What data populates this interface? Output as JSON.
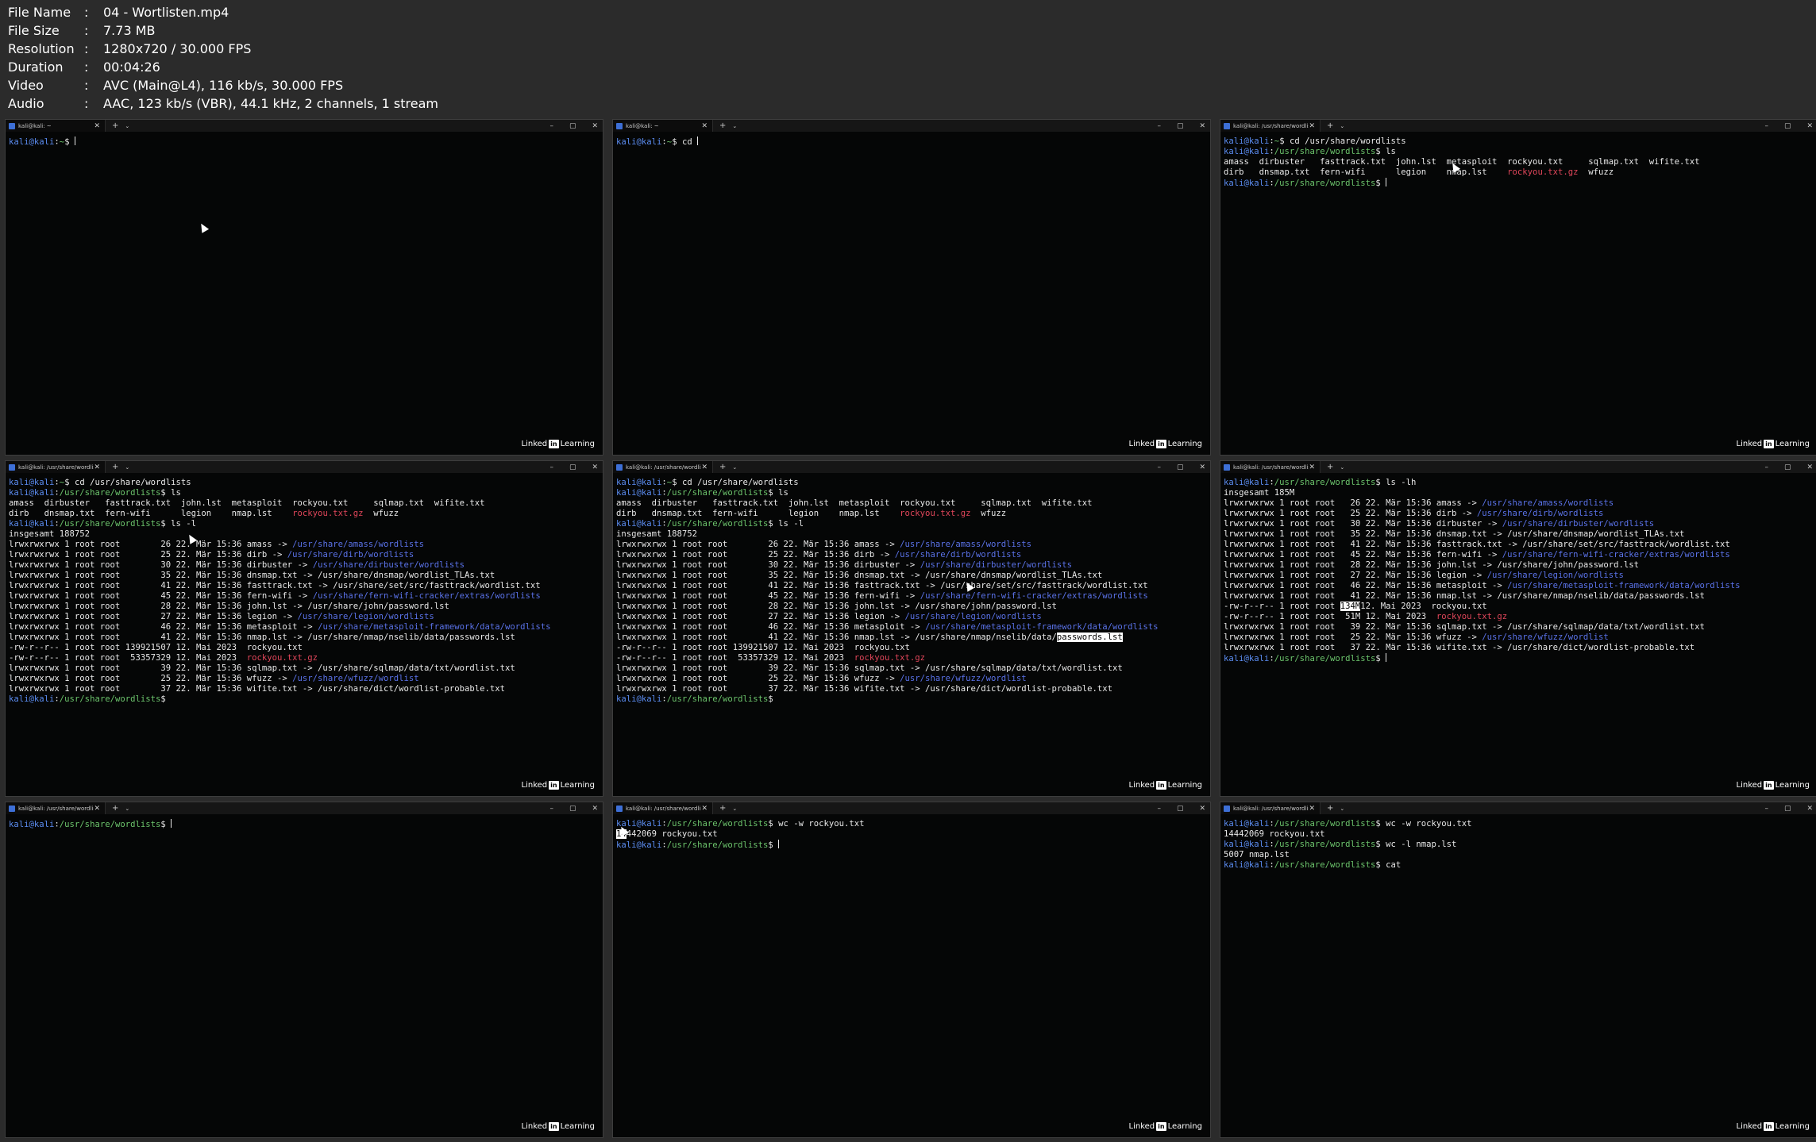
{
  "meta": [
    {
      "key": "File Name",
      "value": "04 - Wortlisten.mp4"
    },
    {
      "key": "File Size",
      "value": "7.73 MB"
    },
    {
      "key": "Resolution",
      "value": "1280x720 / 30.000 FPS"
    },
    {
      "key": "Duration",
      "value": "00:04:26"
    },
    {
      "key": "Video",
      "value": "AVC (Main@L4), 116 kb/s, 30.000 FPS"
    },
    {
      "key": "Audio",
      "value": "AAC, 123 kb/s (VBR), 44.1 kHz, 2 channels, 1 stream"
    }
  ],
  "meta_sep": ":",
  "brand": {
    "text1": "Linked",
    "in": "in",
    "text2": "Learning"
  },
  "ui": {
    "close": "✕",
    "new_tab": "+",
    "dropdown": "⌄",
    "minimize": "–",
    "restore": "▢",
    "win_close": "✕"
  },
  "panes": [
    {
      "tab": "kali@kali: ~",
      "lines": [
        [
          [
            "p-user",
            "kali@kali"
          ],
          [
            "",
            "∶"
          ],
          [
            "p-path",
            "~"
          ],
          [
            "",
            "$ "
          ],
          [
            "cursor",
            ""
          ]
        ]
      ]
    },
    {
      "tab": "kali@kali: ~",
      "lines": [
        [
          [
            "p-user",
            "kali@kali"
          ],
          [
            "",
            "∶"
          ],
          [
            "p-path",
            "~"
          ],
          [
            "",
            "$ cd "
          ],
          [
            "cursor",
            ""
          ]
        ]
      ]
    },
    {
      "tab": "kali@kali: /usr/share/wordlist",
      "lines": [
        [
          [
            "p-user",
            "kali@kali"
          ],
          [
            "",
            "∶"
          ],
          [
            "p-path",
            "~"
          ],
          [
            "",
            "$ cd /usr/share/wordlists"
          ]
        ],
        [
          [
            "p-user",
            "kali@kali"
          ],
          [
            "",
            "∶"
          ],
          [
            "p-path",
            "/usr/share/wordlists"
          ],
          [
            "",
            "$ ls"
          ]
        ],
        [
          [
            "",
            "amass  dirbuster   fasttrack.txt  john.lst  metasploit  rockyou.txt     sqlmap.txt  wifite.txt"
          ]
        ],
        [
          [
            "",
            "dirb   dnsmap.txt  fern-wifi      legion    nmap.lst    "
          ],
          [
            "gz",
            "rockyou.txt.gz"
          ],
          [
            "",
            "  wfuzz"
          ]
        ],
        [
          [
            "p-user",
            "kali@kali"
          ],
          [
            "",
            "∶"
          ],
          [
            "p-path",
            "/usr/share/wordlists"
          ],
          [
            "",
            "$ "
          ],
          [
            "cursor",
            ""
          ]
        ]
      ]
    },
    {
      "tab": "kali@kali: /usr/share/wordlist",
      "lines": [
        [
          [
            "p-user",
            "kali@kali"
          ],
          [
            "",
            "∶"
          ],
          [
            "p-path",
            "~"
          ],
          [
            "",
            "$ cd /usr/share/wordlists"
          ]
        ],
        [
          [
            "p-user",
            "kali@kali"
          ],
          [
            "",
            "∶"
          ],
          [
            "p-path",
            "/usr/share/wordlists"
          ],
          [
            "",
            "$ ls"
          ]
        ],
        [
          [
            "",
            "amass  dirbuster   fasttrack.txt  john.lst  metasploit  rockyou.txt     sqlmap.txt  wifite.txt"
          ]
        ],
        [
          [
            "",
            "dirb   dnsmap.txt  fern-wifi      legion    nmap.lst    "
          ],
          [
            "gz",
            "rockyou.txt.gz"
          ],
          [
            "",
            "  wfuzz"
          ]
        ],
        [
          [
            "p-user",
            "kali@kali"
          ],
          [
            "",
            "∶"
          ],
          [
            "p-path",
            "/usr/share/wordlists"
          ],
          [
            "",
            "$ ls -l"
          ]
        ],
        [
          [
            "",
            "insgesamt 188752"
          ]
        ],
        [
          [
            "",
            "lrwxrwxrwx 1 root root        26 22. Mär 15:36 amass -> "
          ],
          [
            "link",
            "/usr/share/amass/wordlists"
          ]
        ],
        [
          [
            "",
            "lrwxrwxrwx 1 root root        25 22. Mär 15:36 dirb -> "
          ],
          [
            "link",
            "/usr/share/dirb/wordlists"
          ]
        ],
        [
          [
            "",
            "lrwxrwxrwx 1 root root        30 22. Mär 15:36 dirbuster -> "
          ],
          [
            "link",
            "/usr/share/dirbuster/wordlists"
          ]
        ],
        [
          [
            "",
            "lrwxrwxrwx 1 root root        35 22. Mär 15:36 dnsmap.txt -> /usr/share/dnsmap/wordlist_TLAs.txt"
          ]
        ],
        [
          [
            "",
            "lrwxrwxrwx 1 root root        41 22. Mär 15:36 fasttrack.txt -> /usr/share/set/src/fasttrack/wordlist.txt"
          ]
        ],
        [
          [
            "",
            "lrwxrwxrwx 1 root root        45 22. Mär 15:36 fern-wifi -> "
          ],
          [
            "link",
            "/usr/share/fern-wifi-cracker/extras/wordlists"
          ]
        ],
        [
          [
            "",
            "lrwxrwxrwx 1 root root        28 22. Mär 15:36 john.lst -> /usr/share/john/password.lst"
          ]
        ],
        [
          [
            "",
            "lrwxrwxrwx 1 root root        27 22. Mär 15:36 legion -> "
          ],
          [
            "link",
            "/usr/share/legion/wordlists"
          ]
        ],
        [
          [
            "",
            "lrwxrwxrwx 1 root root        46 22. Mär 15:36 metasploit -> "
          ],
          [
            "link",
            "/usr/share/metasploit-framework/data/wordlists"
          ]
        ],
        [
          [
            "",
            "lrwxrwxrwx 1 root root        41 22. Mär 15:36 nmap.lst -> /usr/share/nmap/nselib/data/passwords.lst"
          ]
        ],
        [
          [
            "",
            "-rw-r--r-- 1 root root 139921507 12. Mai 2023  rockyou.txt"
          ]
        ],
        [
          [
            "",
            "-rw-r--r-- 1 root root  53357329 12. Mai 2023  "
          ],
          [
            "gz",
            "rockyou.txt.gz"
          ]
        ],
        [
          [
            "",
            "lrwxrwxrwx 1 root root        39 22. Mär 15:36 sqlmap.txt -> /usr/share/sqlmap/data/txt/wordlist.txt"
          ]
        ],
        [
          [
            "",
            "lrwxrwxrwx 1 root root        25 22. Mär 15:36 wfuzz -> "
          ],
          [
            "link",
            "/usr/share/wfuzz/wordlist"
          ]
        ],
        [
          [
            "",
            "lrwxrwxrwx 1 root root        37 22. Mär 15:36 wifite.txt -> /usr/share/dict/wordlist-probable.txt"
          ]
        ],
        [
          [
            "p-user",
            "kali@kali"
          ],
          [
            "",
            "∶"
          ],
          [
            "p-path",
            "/usr/share/wordlists"
          ],
          [
            "",
            "$"
          ]
        ]
      ]
    },
    {
      "tab": "kali@kali: /usr/share/wordlist",
      "lines": [
        [
          [
            "p-user",
            "kali@kali"
          ],
          [
            "",
            "∶"
          ],
          [
            "p-path",
            "~"
          ],
          [
            "",
            "$ cd /usr/share/wordlists"
          ]
        ],
        [
          [
            "p-user",
            "kali@kali"
          ],
          [
            "",
            "∶"
          ],
          [
            "p-path",
            "/usr/share/wordlists"
          ],
          [
            "",
            "$ ls"
          ]
        ],
        [
          [
            "",
            "amass  dirbuster   fasttrack.txt  john.lst  metasploit  rockyou.txt     sqlmap.txt  wifite.txt"
          ]
        ],
        [
          [
            "",
            "dirb   dnsmap.txt  fern-wifi      legion    nmap.lst    "
          ],
          [
            "gz",
            "rockyou.txt.gz"
          ],
          [
            "",
            "  wfuzz"
          ]
        ],
        [
          [
            "p-user",
            "kali@kali"
          ],
          [
            "",
            "∶"
          ],
          [
            "p-path",
            "/usr/share/wordlists"
          ],
          [
            "",
            "$ ls -l"
          ]
        ],
        [
          [
            "",
            "insgesamt 188752"
          ]
        ],
        [
          [
            "",
            "lrwxrwxrwx 1 root root        26 22. Mär 15:36 amass -> "
          ],
          [
            "link",
            "/usr/share/amass/wordlists"
          ]
        ],
        [
          [
            "",
            "lrwxrwxrwx 1 root root        25 22. Mär 15:36 dirb -> "
          ],
          [
            "link",
            "/usr/share/dirb/wordlists"
          ]
        ],
        [
          [
            "",
            "lrwxrwxrwx 1 root root        30 22. Mär 15:36 dirbuster -> "
          ],
          [
            "link",
            "/usr/share/dirbuster/wordlists"
          ]
        ],
        [
          [
            "",
            "lrwxrwxrwx 1 root root        35 22. Mär 15:36 dnsmap.txt -> /usr/share/dnsmap/wordlist_TLAs.txt"
          ]
        ],
        [
          [
            "",
            "lrwxrwxrwx 1 root root        41 22. Mär 15:36 fasttrack.txt -> /usr/share/set/src/fasttrack/wordlist.txt"
          ]
        ],
        [
          [
            "",
            "lrwxrwxrwx 1 root root        45 22. Mär 15:36 fern-wifi -> "
          ],
          [
            "link",
            "/usr/share/fern-wifi-cracker/extras/wordlists"
          ]
        ],
        [
          [
            "",
            "lrwxrwxrwx 1 root root        28 22. Mär 15:36 john.lst -> /usr/share/john/password.lst"
          ]
        ],
        [
          [
            "",
            "lrwxrwxrwx 1 root root        27 22. Mär 15:36 legion -> "
          ],
          [
            "link",
            "/usr/share/legion/wordlists"
          ]
        ],
        [
          [
            "",
            "lrwxrwxrwx 1 root root        46 22. Mär 15:36 metasploit -> "
          ],
          [
            "link",
            "/usr/share/metasploit-framework/data/wordlists"
          ]
        ],
        [
          [
            "",
            "lrwxrwxrwx 1 root root        41 22. Mär 15:36 nmap.lst -> /usr/share/nmap/nselib/data/"
          ],
          [
            "hl",
            "passwords.lst"
          ]
        ],
        [
          [
            "",
            "-rw-r--r-- 1 root root 139921507 12. Mai 2023  rockyou.txt"
          ]
        ],
        [
          [
            "",
            "-rw-r--r-- 1 root root  53357329 12. Mai 2023  "
          ],
          [
            "gz",
            "rockyou.txt.gz"
          ]
        ],
        [
          [
            "",
            "lrwxrwxrwx 1 root root        39 22. Mär 15:36 sqlmap.txt -> /usr/share/sqlmap/data/txt/wordlist.txt"
          ]
        ],
        [
          [
            "",
            "lrwxrwxrwx 1 root root        25 22. Mär 15:36 wfuzz -> "
          ],
          [
            "link",
            "/usr/share/wfuzz/wordlist"
          ]
        ],
        [
          [
            "",
            "lrwxrwxrwx 1 root root        37 22. Mär 15:36 wifite.txt -> /usr/share/dict/wordlist-probable.txt"
          ]
        ],
        [
          [
            "p-user",
            "kali@kali"
          ],
          [
            "",
            "∶"
          ],
          [
            "p-path",
            "/usr/share/wordlists"
          ],
          [
            "",
            "$"
          ]
        ]
      ]
    },
    {
      "tab": "kali@kali: /usr/share/wordlist",
      "lines": [
        [
          [
            "p-user",
            "kali@kali"
          ],
          [
            "",
            "∶"
          ],
          [
            "p-path",
            "/usr/share/wordlists"
          ],
          [
            "",
            "$ ls -lh"
          ]
        ],
        [
          [
            "",
            "insgesamt 185M"
          ]
        ],
        [
          [
            "",
            "lrwxrwxrwx 1 root root   26 22. Mär 15:36 amass -> "
          ],
          [
            "link",
            "/usr/share/amass/wordlists"
          ]
        ],
        [
          [
            "",
            "lrwxrwxrwx 1 root root   25 22. Mär 15:36 dirb -> "
          ],
          [
            "link",
            "/usr/share/dirb/wordlists"
          ]
        ],
        [
          [
            "",
            "lrwxrwxrwx 1 root root   30 22. Mär 15:36 dirbuster -> "
          ],
          [
            "link",
            "/usr/share/dirbuster/wordlists"
          ]
        ],
        [
          [
            "",
            "lrwxrwxrwx 1 root root   35 22. Mär 15:36 dnsmap.txt -> /usr/share/dnsmap/wordlist_TLAs.txt"
          ]
        ],
        [
          [
            "",
            "lrwxrwxrwx 1 root root   41 22. Mär 15:36 fasttrack.txt -> /usr/share/set/src/fasttrack/wordlist.txt"
          ]
        ],
        [
          [
            "",
            "lrwxrwxrwx 1 root root   45 22. Mär 15:36 fern-wifi -> "
          ],
          [
            "link",
            "/usr/share/fern-wifi-cracker/extras/wordlists"
          ]
        ],
        [
          [
            "",
            "lrwxrwxrwx 1 root root   28 22. Mär 15:36 john.lst -> /usr/share/john/password.lst"
          ]
        ],
        [
          [
            "",
            "lrwxrwxrwx 1 root root   27 22. Mär 15:36 legion -> "
          ],
          [
            "link",
            "/usr/share/legion/wordlists"
          ]
        ],
        [
          [
            "",
            "lrwxrwxrwx 1 root root   46 22. Mär 15:36 metasploit -> "
          ],
          [
            "link",
            "/usr/share/metasploit-framework/data/wordlists"
          ]
        ],
        [
          [
            "",
            "lrwxrwxrwx 1 root root   41 22. Mär 15:36 nmap.lst -> /usr/share/nmap/nselib/data/passwords.lst"
          ]
        ],
        [
          [
            "",
            "-rw-r--r-- 1 root root "
          ],
          [
            "hl",
            "134M"
          ],
          [
            "",
            "12. Mai 2023  rockyou.txt"
          ]
        ],
        [
          [
            "",
            "-rw-r--r-- 1 root root  51M 12. Mai 2023  "
          ],
          [
            "gz",
            "rockyou.txt.gz"
          ]
        ],
        [
          [
            "",
            "lrwxrwxrwx 1 root root   39 22. Mär 15:36 sqlmap.txt -> /usr/share/sqlmap/data/txt/wordlist.txt"
          ]
        ],
        [
          [
            "",
            "lrwxrwxrwx 1 root root   25 22. Mär 15:36 wfuzz -> "
          ],
          [
            "link",
            "/usr/share/wfuzz/wordlist"
          ]
        ],
        [
          [
            "",
            "lrwxrwxrwx 1 root root   37 22. Mär 15:36 wifite.txt -> /usr/share/dict/wordlist-probable.txt"
          ]
        ],
        [
          [
            "p-user",
            "kali@kali"
          ],
          [
            "",
            "∶"
          ],
          [
            "p-path",
            "/usr/share/wordlists"
          ],
          [
            "",
            "$ "
          ],
          [
            "cursor",
            ""
          ]
        ]
      ]
    },
    {
      "tab": "kali@kali: /usr/share/wordlist",
      "lines": [
        [
          [
            "p-user",
            "kali@kali"
          ],
          [
            "",
            "∶"
          ],
          [
            "p-path",
            "/usr/share/wordlists"
          ],
          [
            "",
            "$ "
          ],
          [
            "cursor",
            ""
          ]
        ]
      ]
    },
    {
      "tab": "kali@kali: /usr/share/wordlist",
      "lines": [
        [
          [
            "p-user",
            "kali@kali"
          ],
          [
            "",
            "∶"
          ],
          [
            "p-path",
            "/usr/share/wordlists"
          ],
          [
            "",
            "$ wc -w rockyou.txt"
          ]
        ],
        [
          [
            "hl",
            "14"
          ],
          [
            "",
            "442069 rockyou.txt"
          ]
        ],
        [
          [
            "p-user",
            "kali@kali"
          ],
          [
            "",
            "∶"
          ],
          [
            "p-path",
            "/usr/share/wordlists"
          ],
          [
            "",
            "$ "
          ],
          [
            "cursor",
            ""
          ]
        ]
      ]
    },
    {
      "tab": "kali@kali: /usr/share/wordlist",
      "lines": [
        [
          [
            "p-user",
            "kali@kali"
          ],
          [
            "",
            "∶"
          ],
          [
            "p-path",
            "/usr/share/wordlists"
          ],
          [
            "",
            "$ wc -w rockyou.txt"
          ]
        ],
        [
          [
            "",
            "14442069 rockyou.txt"
          ]
        ],
        [
          [
            "p-user",
            "kali@kali"
          ],
          [
            "",
            "∶"
          ],
          [
            "p-path",
            "/usr/share/wordlists"
          ],
          [
            "",
            "$ wc -l nmap.lst"
          ]
        ],
        [
          [
            "",
            "5007 nmap.lst"
          ]
        ],
        [
          [
            "p-user",
            "kali@kali"
          ],
          [
            "",
            "∶"
          ],
          [
            "p-path",
            "/usr/share/wordlists"
          ],
          [
            "",
            "$ cat"
          ]
        ]
      ]
    }
  ]
}
